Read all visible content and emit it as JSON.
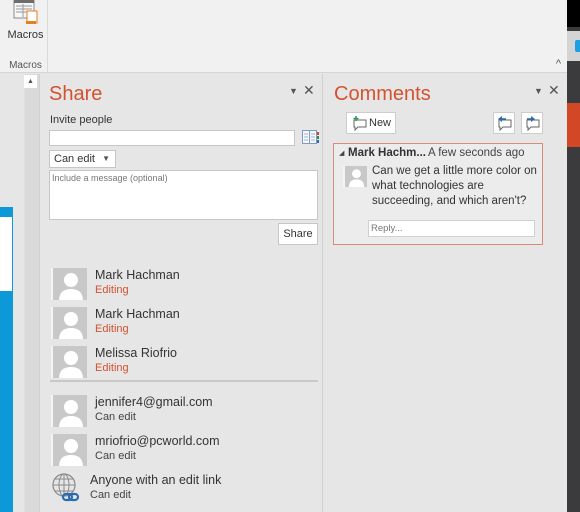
{
  "ribbon": {
    "macros_button_label": "Macros",
    "macros_group_label": "Macros",
    "collapse_glyph": "^"
  },
  "share_pane": {
    "title": "Share",
    "dropdown_glyph": "▼",
    "close_glyph": "✕",
    "invite_label": "Invite people",
    "invite_value": "",
    "permission_selected": "Can edit",
    "message_placeholder": "Include a message (optional)",
    "share_button_label": "Share",
    "people": [
      {
        "name": "Mark Hachman",
        "status": "Editing",
        "type": "editing"
      },
      {
        "name": "Mark Hachman",
        "status": "Editing",
        "type": "editing"
      },
      {
        "name": "Melissa Riofrio",
        "status": "Editing",
        "type": "editing"
      }
    ],
    "invitees": [
      {
        "name": "jennifer4@gmail.com",
        "status": "Can edit"
      },
      {
        "name": "mriofrio@pcworld.com",
        "status": "Can edit"
      }
    ],
    "link": {
      "name": "Anyone with an edit link",
      "status": "Can edit",
      "icon": "globe-link-icon"
    }
  },
  "comments_pane": {
    "title": "Comments",
    "dropdown_glyph": "▼",
    "close_glyph": "✕",
    "new_button_label": "New",
    "comment": {
      "author": "Mark Hachm...",
      "time": "A few seconds ago",
      "text": "Can we get a little more color on what technologies are succeeding, and which aren't?",
      "reply_placeholder": "Reply..."
    }
  },
  "colors": {
    "accent": "#d35230",
    "pane_bg": "#e6e6e6",
    "slide_blue": "#0b9ad7",
    "comment_border": "#d98b7a"
  }
}
